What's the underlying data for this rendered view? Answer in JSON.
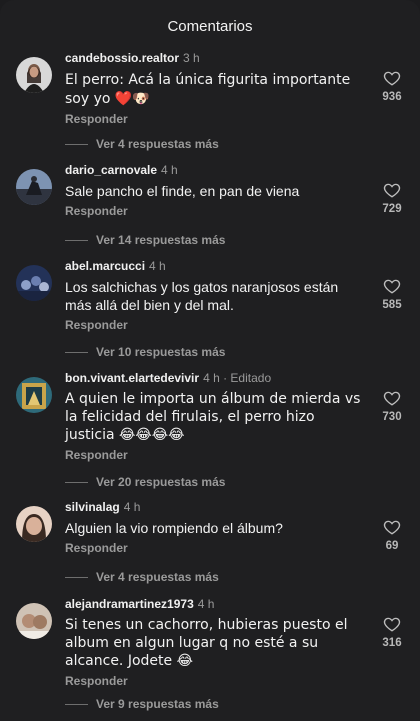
{
  "header": {
    "title": "Comentarios"
  },
  "reply_label": "Responder",
  "comments": [
    {
      "username": "candebossio.realtor",
      "time": "3 h",
      "text": "El perro: Acá la única figurita importante soy yo ❤️🐶",
      "likes": "936",
      "more": "Ver 4 respuestas más",
      "avatar_color": "#8a6a5a"
    },
    {
      "username": "dario_carnovale",
      "time": "4 h",
      "text": "Sale pancho el finde, en pan de viena",
      "likes": "729",
      "more": "Ver 14 respuestas más",
      "avatar_color": "#5f7391"
    },
    {
      "username": "abel.marcucci",
      "time": "4 h",
      "text": "Los salchichas y los gatos naranjosos están más allá del bien y del mal.",
      "likes": "585",
      "more": "Ver 10 respuestas más",
      "avatar_color": "#3b4f8a"
    },
    {
      "username": "bon.vivant.elartedevivir",
      "time": "4 h",
      "edited": "· Editado",
      "text": "A quien le importa un álbum de mierda vs la felicidad del firulais, el perro hizo justicia 😂😂😂😂",
      "likes": "730",
      "more": "Ver 20 respuestas más",
      "avatar_color": "#4d7a8a"
    },
    {
      "username": "silvinalag",
      "time": "4 h",
      "text": "Alguien la vio rompiendo el álbum?",
      "likes": "69",
      "more": "Ver 4 respuestas más",
      "avatar_color": "#c9a48d"
    },
    {
      "username": "alejandramartinez1973",
      "time": "4 h",
      "text": "Si tenes un cachorro, hubieras puesto el album en algun lugar q no esté a su alcance. Jodete 😂",
      "likes": "316",
      "more": "Ver 9 respuestas más",
      "avatar_color": "#b99c86"
    }
  ]
}
